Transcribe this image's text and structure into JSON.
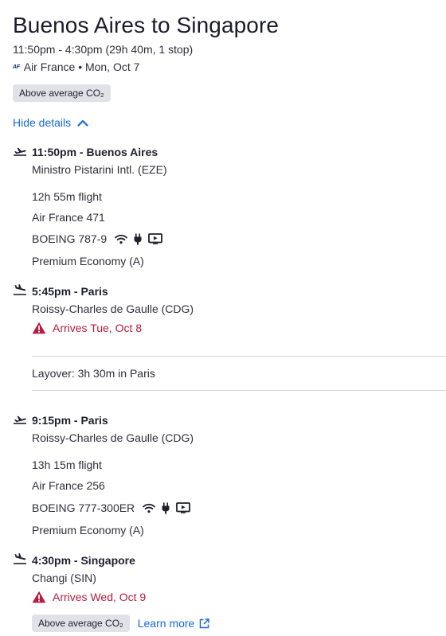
{
  "header": {
    "title": "Buenos Aires to Singapore",
    "subtitle": "11:50pm - 4:30pm (29h 40m, 1 stop)",
    "airline_logo": "AF",
    "airline_date": "Air France • Mon, Oct 7",
    "co2_badge": "Above average CO₂"
  },
  "toggle": {
    "label": "Hide details",
    "icon": "chevron-up-icon"
  },
  "segments": [
    {
      "departure": {
        "time_city": "11:50pm - Buenos Aires",
        "airport": "Ministro Pistarini Intl. (EZE)",
        "icon": "takeoff-icon"
      },
      "duration": "12h 55m flight",
      "flight": "Air France 471",
      "aircraft": "BOEING 787-9",
      "amenities": [
        "wifi-icon",
        "power-plug-icon",
        "entertainment-screen-icon"
      ],
      "cabin": "Premium Economy (A)",
      "arrival": {
        "time_city": "5:45pm - Paris",
        "airport": "Roissy-Charles de Gaulle (CDG)",
        "icon": "landing-icon",
        "warning": "Arrives Tue, Oct 8"
      }
    },
    {
      "departure": {
        "time_city": "9:15pm - Paris",
        "airport": "Roissy-Charles de Gaulle (CDG)",
        "icon": "takeoff-icon"
      },
      "duration": "13h 15m flight",
      "flight": "Air France 256",
      "aircraft": "BOEING 777-300ER",
      "amenities": [
        "wifi-icon",
        "power-plug-icon",
        "entertainment-screen-icon"
      ],
      "cabin": "Premium Economy (A)",
      "arrival": {
        "time_city": "4:30pm - Singapore",
        "airport": "Changi (SIN)",
        "icon": "landing-icon",
        "warning": "Arrives Wed, Oct 9"
      }
    }
  ],
  "layover": "Layover: 3h 30m in Paris",
  "footer": {
    "co2_badge": "Above average CO₂",
    "learn_more": "Learn more"
  },
  "colors": {
    "link": "#1668e3",
    "warning": "#b31d40",
    "badge_bg": "#e1e2e8",
    "text": "#1f1f2e"
  }
}
